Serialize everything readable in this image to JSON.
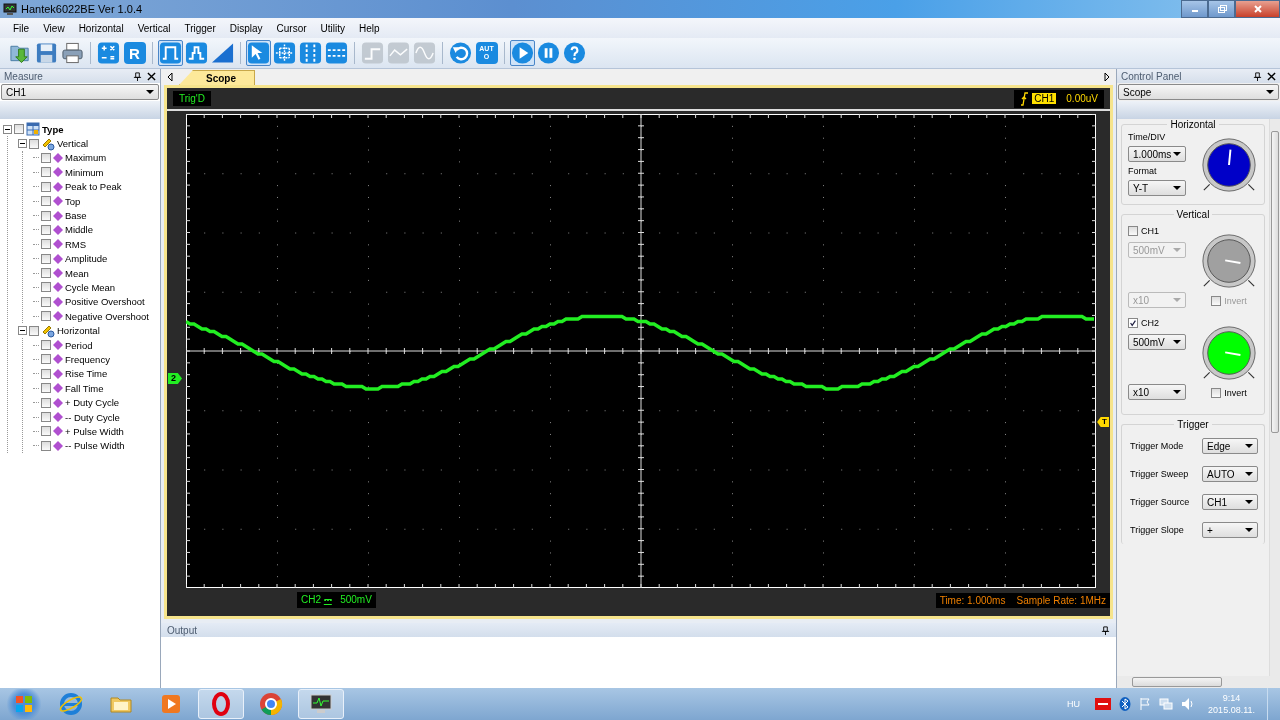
{
  "window": {
    "title": "Hantek6022BE Ver 1.0.4"
  },
  "menu": [
    "File",
    "View",
    "Horizontal",
    "Vertical",
    "Trigger",
    "Display",
    "Cursor",
    "Utility",
    "Help"
  ],
  "toolbar": [
    {
      "items": [
        {
          "kind": "open",
          "selected": false,
          "disabled": false
        },
        {
          "kind": "save",
          "selected": false,
          "disabled": false
        },
        {
          "kind": "print",
          "selected": false,
          "disabled": false
        }
      ]
    },
    {
      "items": [
        {
          "kind": "math",
          "selected": false,
          "disabled": false
        },
        {
          "kind": "letter",
          "label": "R",
          "selected": false,
          "disabled": false
        }
      ]
    },
    {
      "items": [
        {
          "kind": "pulse",
          "selected": true,
          "disabled": false
        },
        {
          "kind": "stairs",
          "selected": false,
          "disabled": false
        },
        {
          "kind": "ramp",
          "selected": false,
          "disabled": false
        }
      ]
    },
    {
      "items": [
        {
          "kind": "pointer",
          "selected": true,
          "disabled": false
        },
        {
          "kind": "crosshair",
          "selected": false,
          "disabled": false
        },
        {
          "kind": "vlines",
          "selected": false,
          "disabled": false
        },
        {
          "kind": "hlines",
          "selected": false,
          "disabled": false
        }
      ]
    },
    {
      "items": [
        {
          "kind": "step",
          "selected": false,
          "disabled": true
        },
        {
          "kind": "triangle",
          "selected": false,
          "disabled": true
        },
        {
          "kind": "sine",
          "selected": false,
          "disabled": true
        }
      ]
    },
    {
      "items": [
        {
          "kind": "undo",
          "selected": false,
          "disabled": false
        },
        {
          "kind": "letter",
          "label": "AUTO",
          "selected": false,
          "disabled": false
        }
      ]
    },
    {
      "items": [
        {
          "kind": "play",
          "selected": true,
          "disabled": false
        },
        {
          "kind": "pause",
          "selected": false,
          "disabled": false
        },
        {
          "kind": "help",
          "selected": false,
          "disabled": false
        }
      ]
    }
  ],
  "measure": {
    "title": "Measure",
    "source": "CH1",
    "tree": [
      {
        "label": "Type",
        "checked": false,
        "expanded": true,
        "children": [
          {
            "label": "Vertical",
            "checked": false,
            "expanded": true,
            "children": [
              {
                "label": "Maximum",
                "checked": false
              },
              {
                "label": "Minimum",
                "checked": false
              },
              {
                "label": "Peak to Peak",
                "checked": false
              },
              {
                "label": "Top",
                "checked": false
              },
              {
                "label": "Base",
                "checked": false
              },
              {
                "label": "Middle",
                "checked": false
              },
              {
                "label": "RMS",
                "checked": false
              },
              {
                "label": "Amplitude",
                "checked": false
              },
              {
                "label": "Mean",
                "checked": false
              },
              {
                "label": "Cycle Mean",
                "checked": false
              },
              {
                "label": "Positive Overshoot",
                "checked": false
              },
              {
                "label": "Negative Overshoot",
                "checked": false
              }
            ]
          },
          {
            "label": "Horizontal",
            "checked": false,
            "expanded": true,
            "children": [
              {
                "label": "Period",
                "checked": false
              },
              {
                "label": "Frequency",
                "checked": false
              },
              {
                "label": "Rise Time",
                "checked": false
              },
              {
                "label": "Fall Time",
                "checked": false
              },
              {
                "label": "+ Duty Cycle",
                "checked": false
              },
              {
                "label": "-- Duty Cycle",
                "checked": false
              },
              {
                "label": "+ Pulse Width",
                "checked": false
              },
              {
                "label": "-- Pulse Width",
                "checked": false
              }
            ]
          }
        ]
      }
    ]
  },
  "scope": {
    "tabs": [
      {
        "label": "Scope",
        "selected": true
      }
    ],
    "status": "Trig'D",
    "trigger_channel": "CH1",
    "trigger_level": "0.00uV",
    "channel_marker": "2",
    "trigger_marker": "T",
    "channel": "CH2",
    "coupling": "⎓",
    "volts": "500mV",
    "time": "Time: 1.000ms",
    "sample_rate": "Sample Rate: 1MHz"
  },
  "output": {
    "title": "Output"
  },
  "control_panel": {
    "title": "Control Panel",
    "mode": "Scope",
    "horizontal": {
      "title": "Horizontal",
      "time_label": "Time/DIV",
      "time": "1.000ms",
      "format_label": "Format",
      "format": "Y-T",
      "color": "#0000c8"
    },
    "vertical": {
      "title": "Vertical",
      "channels": [
        {
          "name": "CH1",
          "checked": false,
          "volts": "500mV",
          "probe": "x10",
          "invert_label": "Invert",
          "invert": false,
          "color": "#a0a0a0"
        },
        {
          "name": "CH2",
          "checked": true,
          "volts": "500mV",
          "probe": "x10",
          "invert_label": "Invert",
          "invert": false,
          "color": "#00ff00"
        }
      ]
    },
    "trigger": {
      "title": "Trigger",
      "rows": [
        {
          "label": "Trigger Mode",
          "value": "Edge"
        },
        {
          "label": "Trigger Sweep",
          "value": "AUTO"
        },
        {
          "label": "Trigger Source",
          "value": "CH1"
        },
        {
          "label": "Trigger Slope",
          "value": "+"
        }
      ]
    }
  },
  "taskbar": {
    "apps": [
      {
        "kind": "ie",
        "selected": false
      },
      {
        "kind": "folder",
        "selected": false
      },
      {
        "kind": "media",
        "selected": false
      },
      {
        "kind": "opera",
        "selected": true
      },
      {
        "kind": "chrome",
        "selected": false
      },
      {
        "kind": "scope",
        "selected": true
      }
    ],
    "language": "HU",
    "time": "9:14",
    "date": "2015.08.11."
  }
}
